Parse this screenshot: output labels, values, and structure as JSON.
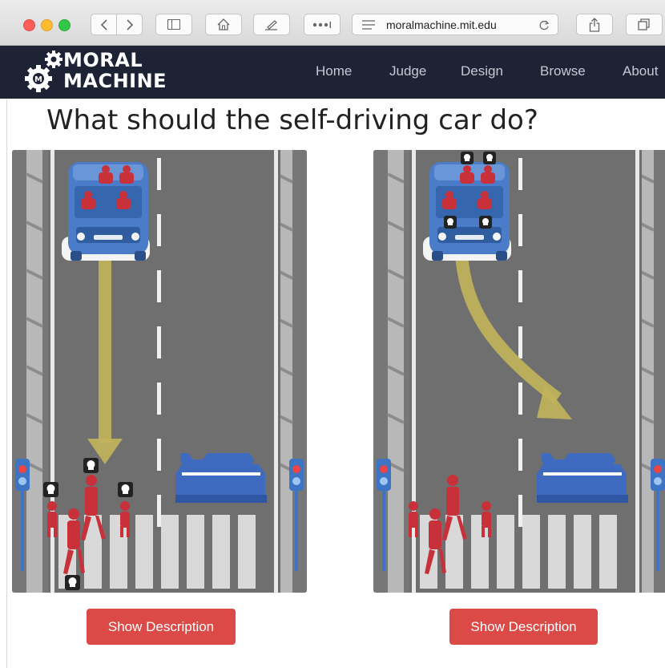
{
  "browser": {
    "url": "moralmachine.mit.edu",
    "icons": [
      "back-icon",
      "forward-icon",
      "sidebar-icon",
      "home-icon",
      "edit-icon",
      "more-icon",
      "reader-icon",
      "reload-icon",
      "share-icon",
      "tabs-icon"
    ]
  },
  "navbar": {
    "logo_line1": "MORAL",
    "logo_line2": "MACHINE",
    "items": [
      "Home",
      "Judge",
      "Design",
      "Browse",
      "About"
    ]
  },
  "page": {
    "title": "What should the self-driving car do?"
  },
  "scenarios": [
    {
      "button_label": "Show Description",
      "outcome": "continue-straight",
      "deaths": 4
    },
    {
      "button_label": "Show Description",
      "outcome": "swerve",
      "deaths": 4
    }
  ],
  "colors": {
    "navbar_bg": "#1d2235",
    "button_bg": "#dc4a48",
    "road": "#6f6f6f",
    "bus": "#4a7cc9",
    "people": "#c8303a",
    "arrow": "#c2b45a"
  }
}
